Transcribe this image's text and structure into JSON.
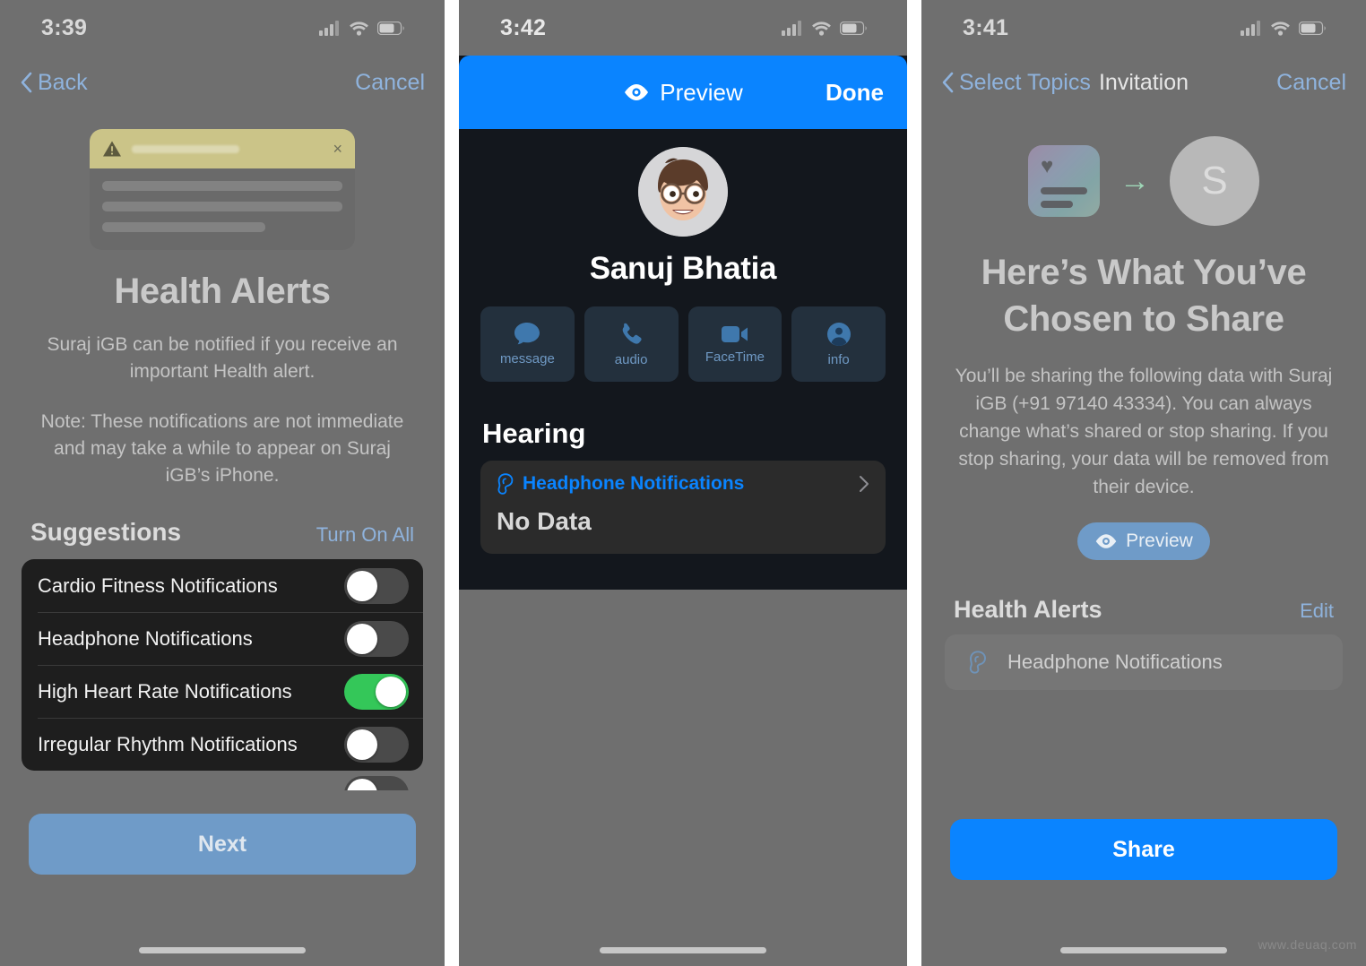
{
  "panel1": {
    "status": {
      "time": "3:39",
      "icons": [
        "cellular-signal-icon",
        "wifi-icon",
        "battery-icon"
      ]
    },
    "nav": {
      "back_label": "Back",
      "cancel_label": "Cancel"
    },
    "ghost_card": {
      "icon": "warning-triangle-icon",
      "close": "×"
    },
    "title": "Health Alerts",
    "paragraph1": "Suraj iGB can be notified if you receive an important Health alert.",
    "paragraph2": "Note: These notifications are not immediate and may take a while to appear on Suraj iGB’s iPhone.",
    "section": {
      "heading": "Suggestions",
      "action": "Turn On All"
    },
    "toggles": [
      {
        "label": "Cardio Fitness Notifications",
        "on": false
      },
      {
        "label": "Headphone Notifications",
        "on": false
      },
      {
        "label": "High Heart Rate Notifications",
        "on": true
      },
      {
        "label": "Irregular Rhythm Notifications",
        "on": false
      }
    ],
    "cta": "Next"
  },
  "panel2": {
    "status": {
      "time": "3:42"
    },
    "topbar": {
      "preview_label": "Preview",
      "preview_icon": "eye-icon",
      "done_label": "Done"
    },
    "contact_name": "Sanuj Bhatia",
    "actions": [
      {
        "label": "message",
        "icon": "message-bubble-icon"
      },
      {
        "label": "audio",
        "icon": "phone-icon"
      },
      {
        "label": "FaceTime",
        "icon": "video-camera-icon"
      },
      {
        "label": "info",
        "icon": "person-circle-icon"
      }
    ],
    "section_heading": "Hearing",
    "card": {
      "row_icon": "ear-icon",
      "row_label": "Headphone Notifications",
      "chevron": "chevron-right-icon",
      "value": "No Data"
    }
  },
  "panel3": {
    "status": {
      "time": "3:41"
    },
    "nav": {
      "back_label": "Select Topics",
      "title": "Invitation",
      "cancel_label": "Cancel"
    },
    "hero": {
      "card_icon": "health-card-icon",
      "heart": "♥",
      "arrow": "→",
      "avatar_initial": "S"
    },
    "title": "Here’s What You’ve Chosen to Share",
    "body": "You’ll be sharing the following data with Suraj iGB (+91 97140 43334). You can always change what’s shared or stop sharing. If you stop sharing, your data will be removed from their device.",
    "preview_button": {
      "label": "Preview",
      "icon": "eye-icon"
    },
    "list_head": {
      "heading": "Health Alerts",
      "action": "Edit"
    },
    "list_items": [
      {
        "icon": "ear-icon",
        "label": "Headphone Notifications"
      }
    ],
    "cta": "Share"
  },
  "watermark": "www.deuaq.com",
  "colors": {
    "accent_blue": "#0a84ff",
    "muted_blue": "#6f9bc8",
    "link_blue": "#8fb3dd",
    "toggle_on_green": "#34c759",
    "dim_bg": "#6f6f6f",
    "dark_card": "#1e1e1e"
  }
}
